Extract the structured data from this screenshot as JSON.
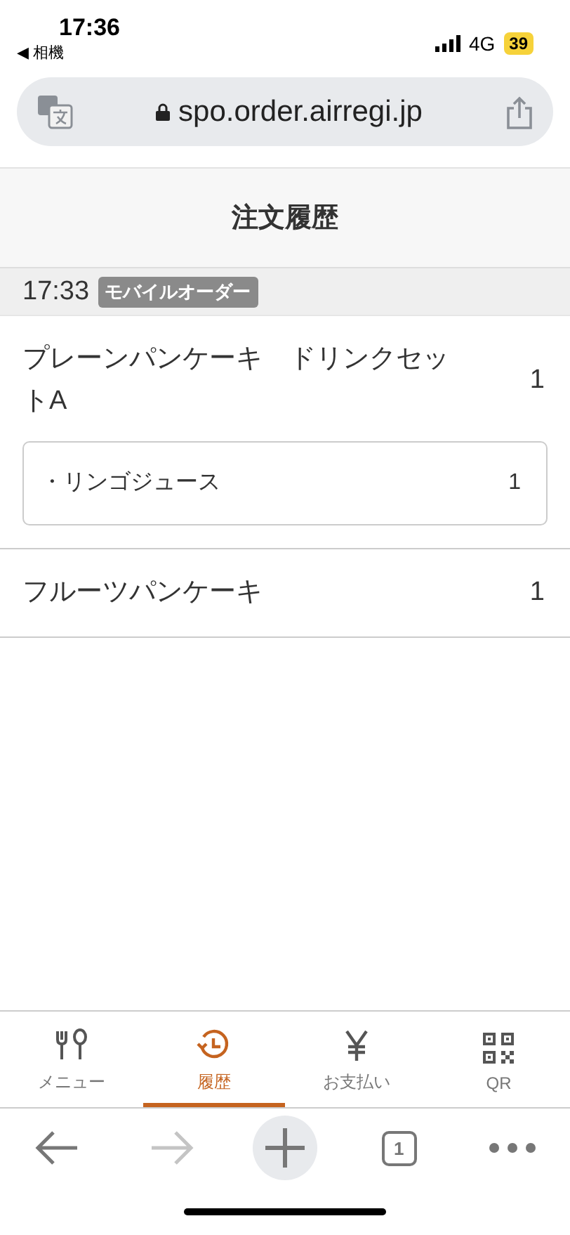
{
  "status_bar": {
    "time": "17:36",
    "back_app": "◀ 相機",
    "network": "4G",
    "battery": "39"
  },
  "url_bar": {
    "url": "spo.order.airregi.jp"
  },
  "header": {
    "title": "注文履歴"
  },
  "orders": [
    {
      "time": "17:33",
      "tag": "モバイルオーダー",
      "items": [
        {
          "name": "プレーンパンケーキ　ドリンクセットA",
          "qty": "1",
          "options": [
            {
              "name": "・リンゴジュース",
              "qty": "1"
            }
          ]
        },
        {
          "name": "フルーツパンケーキ",
          "qty": "1"
        }
      ]
    }
  ],
  "tabs": [
    {
      "kind": "menu",
      "label": "メニュー",
      "selected": false
    },
    {
      "kind": "history",
      "label": "履歴",
      "selected": true
    },
    {
      "kind": "payment",
      "label": "お支払い",
      "selected": false
    },
    {
      "kind": "qr",
      "label": "QR",
      "selected": false
    }
  ],
  "browser_toolbar": {
    "tab_count": "1",
    "forward_disabled": true
  }
}
